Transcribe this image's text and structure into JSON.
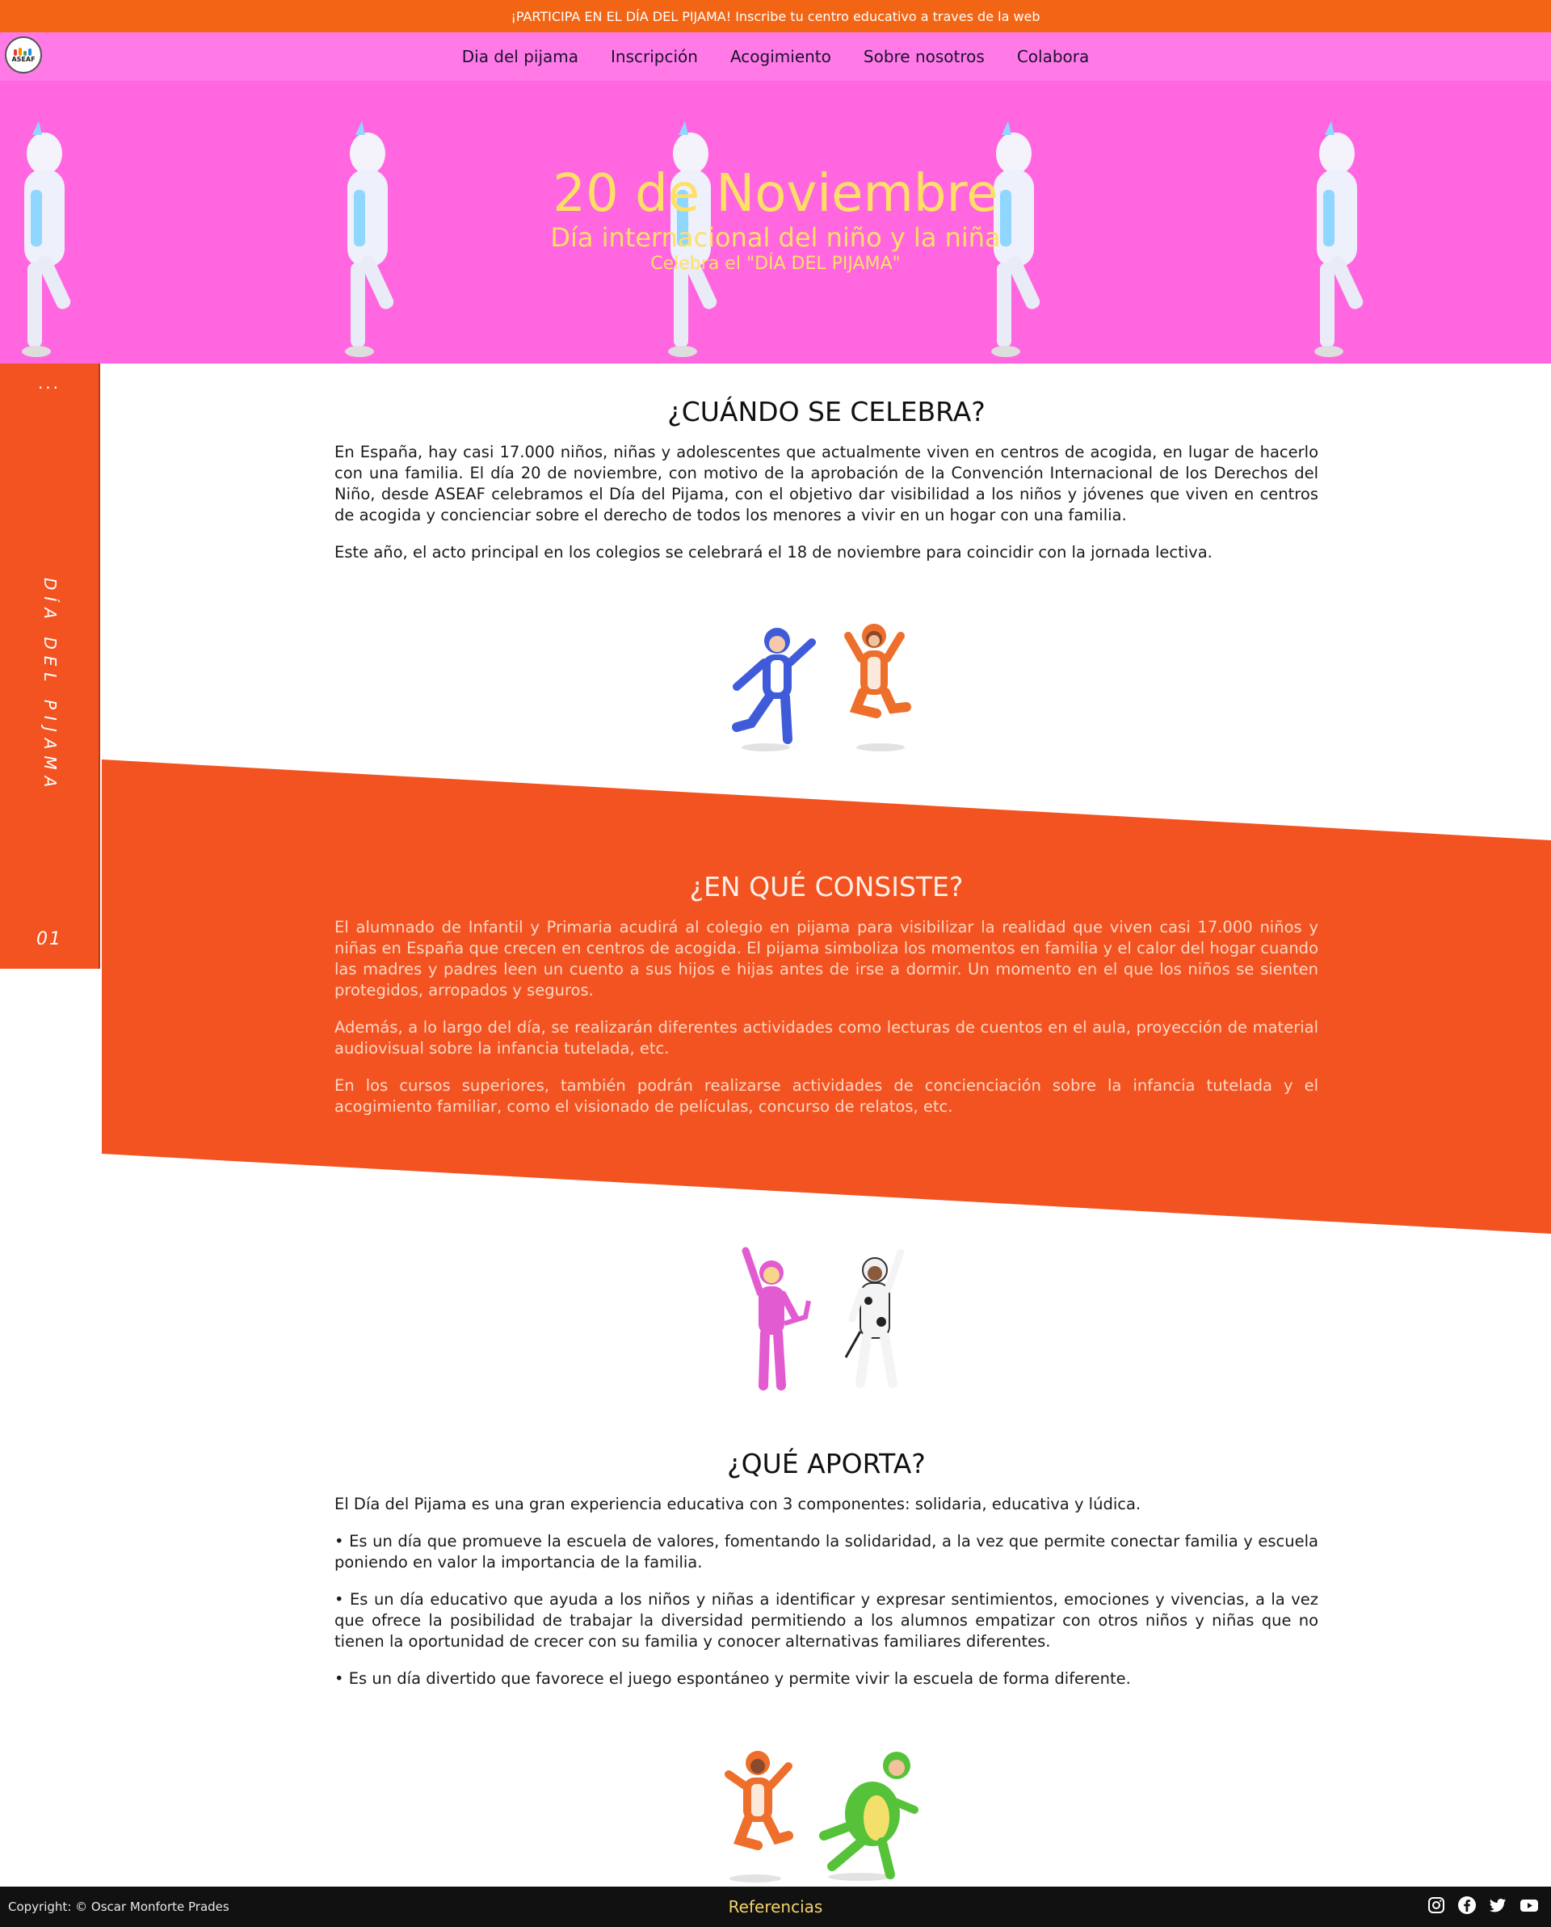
{
  "announcement": "¡PARTICIPA EN EL DÍA DEL PIJAMA! Inscribe tu centro educativo a traves de la web",
  "logo": {
    "text": "ASEAF"
  },
  "nav": [
    {
      "label": "Dia del pijama"
    },
    {
      "label": "Inscripción"
    },
    {
      "label": "Acogimiento"
    },
    {
      "label": "Sobre nosotros"
    },
    {
      "label": "Colabora"
    }
  ],
  "hero": {
    "title": "20 de Noviembre",
    "subtitle": "Día internacional del niño y la niña",
    "tagline": "Celebra el \"DÍA DEL PIJAMA\""
  },
  "side": {
    "dots": "...",
    "label": "DÍA DEL PIJAMA",
    "number": "01"
  },
  "sections": [
    {
      "title": "¿CUÁNDO SE CELEBRA?",
      "paragraphs": [
        "En España, hay casi 17.000 niños, niñas y adolescentes que actualmente viven en centros de acogida, en lugar de hacerlo con una familia. El día 20 de noviembre, con motivo de la aprobación de la Convención Internacional de los Derechos del Niño, desde ASEAF celebramos el Día del Pijama, con el objetivo dar visibilidad a los niños y jóvenes que viven en centros de acogida y concienciar sobre el derecho de todos los menores a vivir en un hogar con una familia.",
        "Este año, el acto principal en los colegios se celebrará el 18 de noviembre para coincidir con la jornada lectiva."
      ]
    },
    {
      "title": "¿EN QUÉ CONSISTE?",
      "paragraphs": [
        "El alumnado de Infantil y Primaria acudirá al colegio en pijama para visibilizar la realidad que viven casi 17.000 niños y niñas en España que crecen en centros de acogida. El pijama simboliza los momentos en familia y el calor del hogar cuando las madres y padres leen un cuento a sus hijos e hijas antes de irse a dormir. Un momento en el que los niños se sienten protegidos, arropados y seguros.",
        "Además, a lo largo del día, se realizarán diferentes actividades como lecturas de cuentos en el aula, proyección de material audiovisual sobre la infancia tutelada, etc.",
        "En los cursos superiores, también podrán realizarse actividades de concienciación sobre la infancia tutelada y el acogimiento familiar, como el visionado de películas, concurso de relatos, etc."
      ]
    },
    {
      "title": "¿QUÉ APORTA?",
      "paragraphs": [
        "El Día del Pijama es una gran experiencia educativa con 3 componentes: solidaria, educativa y lúdica.",
        "•  Es un día que promueve la escuela de valores, fomentando la solidaridad, a la vez que permite conectar familia y escuela poniendo en valor la importancia de la familia.",
        "•  Es un día educativo que ayuda a los niños y niñas a identificar y expresar sentimientos, emociones y vivencias, a la vez que ofrece la posibilidad de trabajar la diversidad permitiendo a los alumnos empatizar con otros niños y niñas que no tienen la oportunidad de crecer con su familia y conocer alternativas familiares diferentes.",
        "•  Es un día divertido que favorece el juego espontáneo y permite vivir la escuela de forma diferente."
      ]
    }
  ],
  "footer": {
    "copyright": "Copyright: © Oscar Monforte Prades",
    "references": "Referencias",
    "social": [
      "instagram-icon",
      "facebook-icon",
      "twitter-icon",
      "youtube-icon"
    ]
  },
  "colors": {
    "announcement_bg": "#f26514",
    "nav_bg": "#ff7ae6",
    "hero_bg": "#ff66e0",
    "hero_text": "#ffe066",
    "accent_orange": "#f25321",
    "footer_bg": "#111111",
    "references_text": "#f2d36b"
  }
}
